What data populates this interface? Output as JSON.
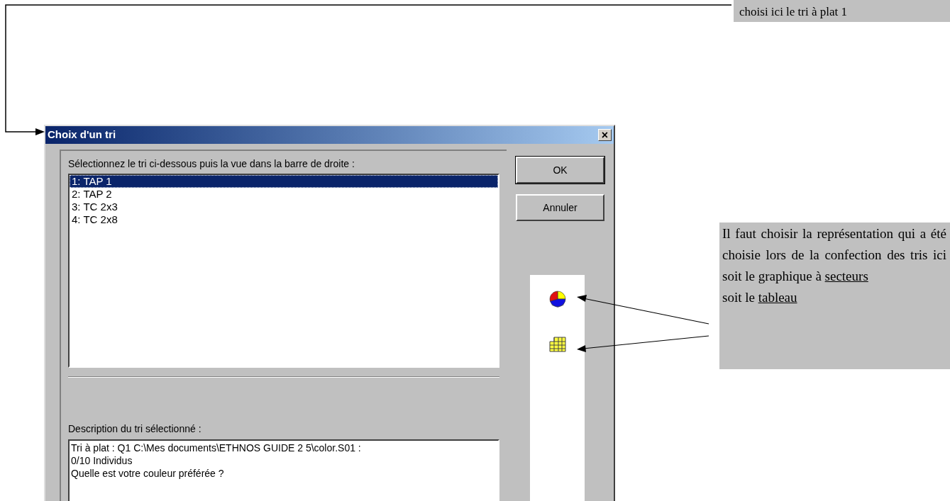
{
  "top_note": {
    "text": "choisi ici le tri à plat 1"
  },
  "dialog": {
    "title": "Choix d'un tri",
    "close": "×",
    "instruction": "Sélectionnez le tri ci-dessous puis la vue dans la barre de droite :",
    "tris": [
      {
        "label": "1: TAP 1",
        "selected": true
      },
      {
        "label": "2: TAP 2",
        "selected": false
      },
      {
        "label": "3: TC 2x3",
        "selected": false
      },
      {
        "label": "4: TC 2x8",
        "selected": false
      }
    ],
    "description_label": "Description du tri sélectionné :",
    "description_lines": [
      "Tri à plat : Q1 C:\\Mes documents\\ETHNOS GUIDE 2 5\\color.S01 :",
      "0/10 Individus",
      "Quelle est votre couleur préférée ?"
    ],
    "buttons": [
      "OK",
      "Annuler"
    ],
    "views": [
      {
        "kind": "pie"
      },
      {
        "kind": "table"
      }
    ]
  },
  "side_note": {
    "segments": [
      {
        "text": "Il faut choisir la représentation qui a été choisie lors de la confection des tris ici soit le graphique à ",
        "underline": false,
        "new_line": false
      },
      {
        "text": "secteurs",
        "underline": true,
        "new_line": false
      },
      {
        "text": "soit le ",
        "underline": false,
        "new_line": true
      },
      {
        "text": "tableau",
        "underline": true,
        "new_line": false
      }
    ]
  }
}
